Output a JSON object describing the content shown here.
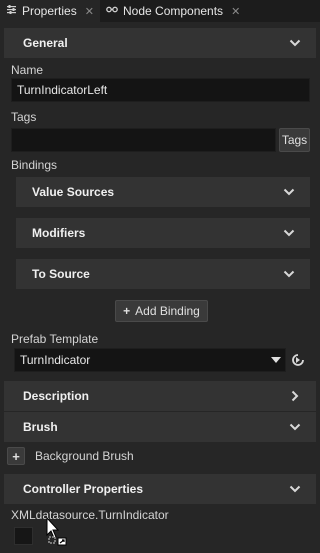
{
  "tabs": [
    {
      "label": "Properties",
      "icon": "sliders-icon",
      "active": true
    },
    {
      "label": "Node Components",
      "icon": "link-icon",
      "active": false
    }
  ],
  "general": {
    "header": "General",
    "name_label": "Name",
    "name_value": "TurnIndicatorLeft",
    "tags_label": "Tags",
    "tags_value": "",
    "tags_button": "Tags",
    "bindings_label": "Bindings",
    "binding_groups": [
      "Value Sources",
      "Modifiers",
      "To Source"
    ],
    "add_binding_label": "Add Binding",
    "prefab_label": "Prefab Template",
    "prefab_value": "TurnIndicator"
  },
  "description": {
    "header": "Description"
  },
  "brush": {
    "header": "Brush",
    "background_brush_label": "Background Brush"
  },
  "controller": {
    "header": "Controller Properties",
    "source_text": "XMLdatasource.TurnIndicator",
    "swatch_color": "#161616"
  },
  "colors": {
    "accent": "#333333",
    "field_bg": "#141414"
  }
}
